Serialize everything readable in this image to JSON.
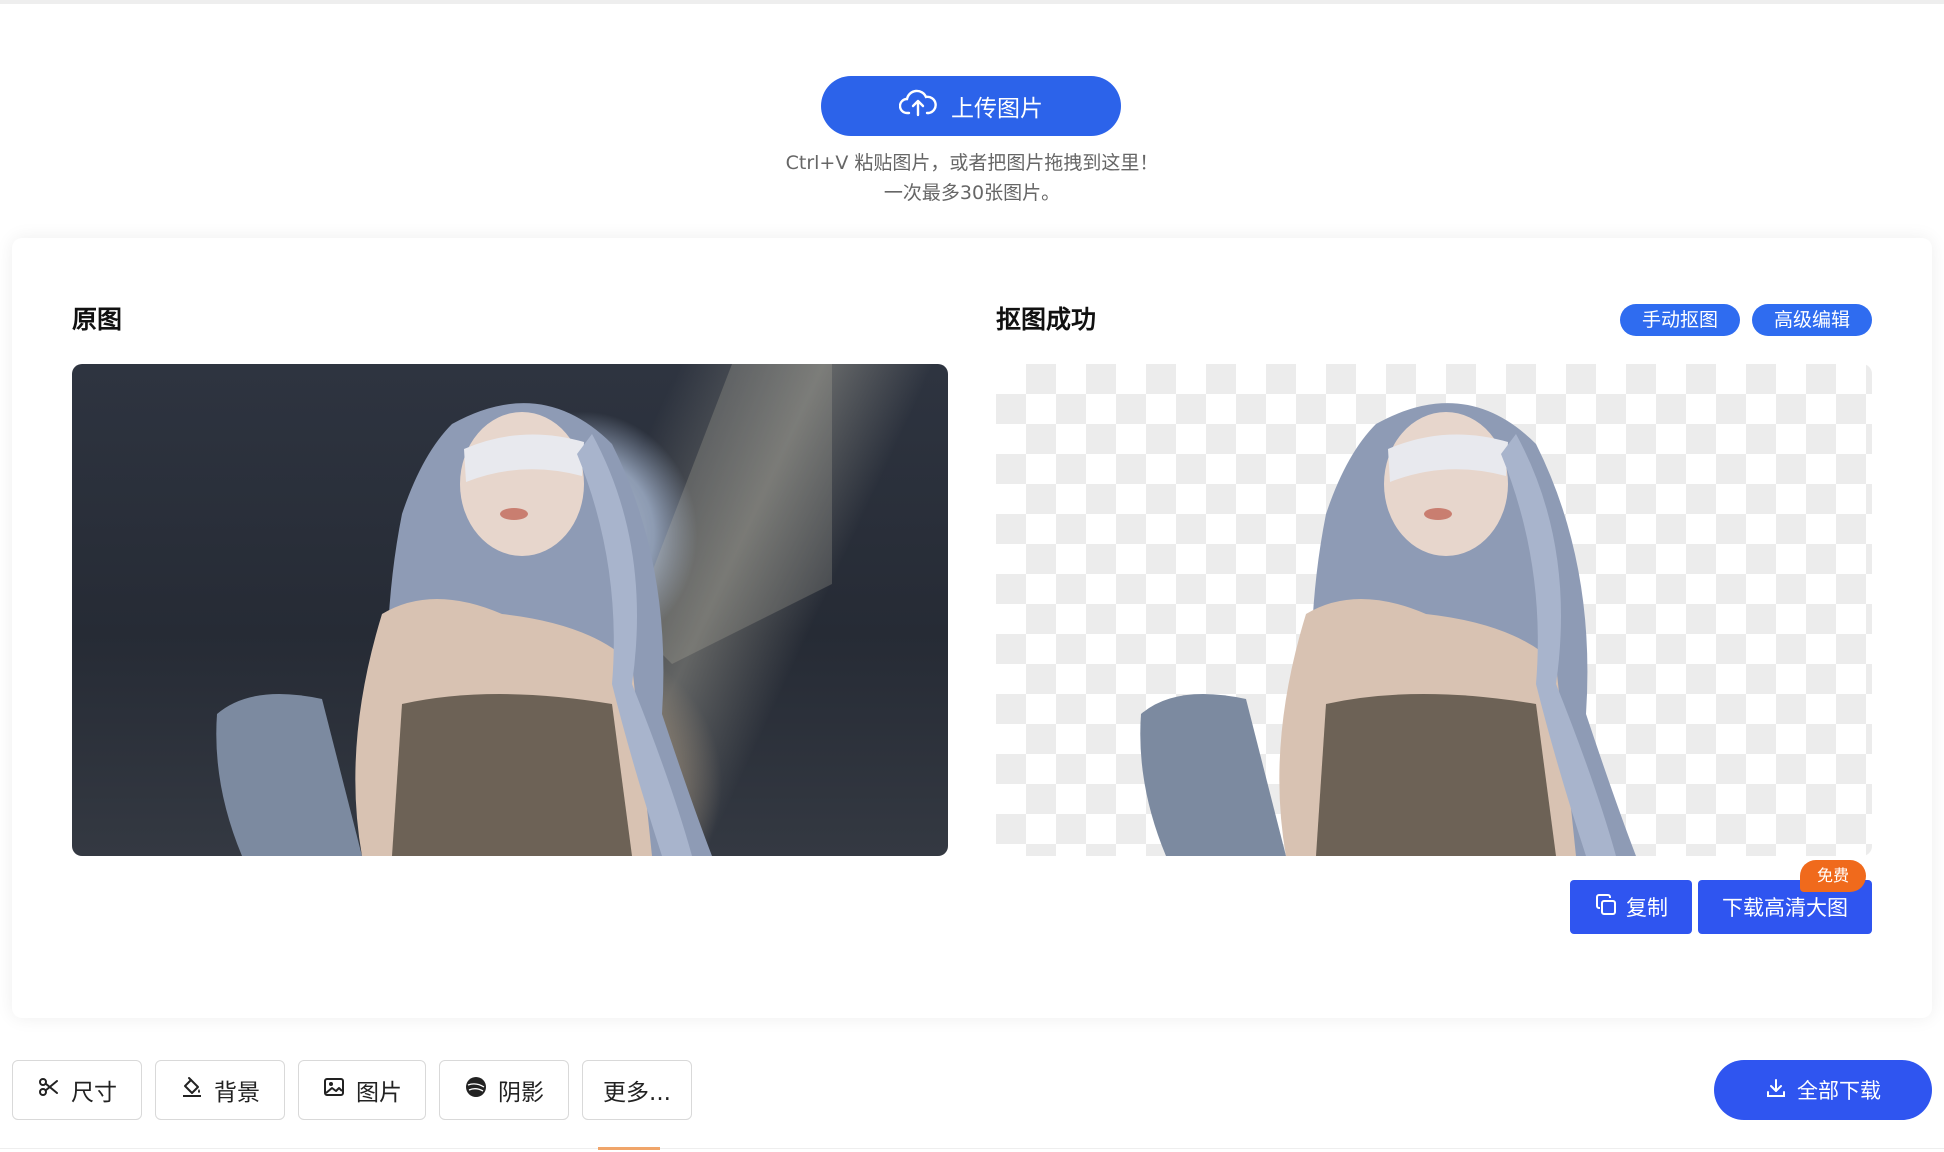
{
  "upload": {
    "button_label": "上传图片",
    "hint_line1": "Ctrl+V 粘贴图片，或者把图片拖拽到这里！",
    "hint_line2": "一次最多30张图片。"
  },
  "original": {
    "title": "原图"
  },
  "result": {
    "title": "抠图成功",
    "manual_cutout": "手动抠图",
    "advanced_edit": "高级编辑",
    "copy_label": "复制",
    "download_hd_label": "下载高清大图",
    "free_badge": "免费"
  },
  "toolbar": {
    "items": [
      {
        "label": "尺寸",
        "icon": "scissors-icon"
      },
      {
        "label": "背景",
        "icon": "paint-bucket-icon"
      },
      {
        "label": "图片",
        "icon": "image-icon"
      },
      {
        "label": "阴影",
        "icon": "shadow-icon"
      },
      {
        "label": "更多..."
      }
    ],
    "download_all_label": "全部下载"
  },
  "colors": {
    "primary": "#2f55f0",
    "upload_button": "#2c63ea",
    "badge": "#f06a1c"
  }
}
